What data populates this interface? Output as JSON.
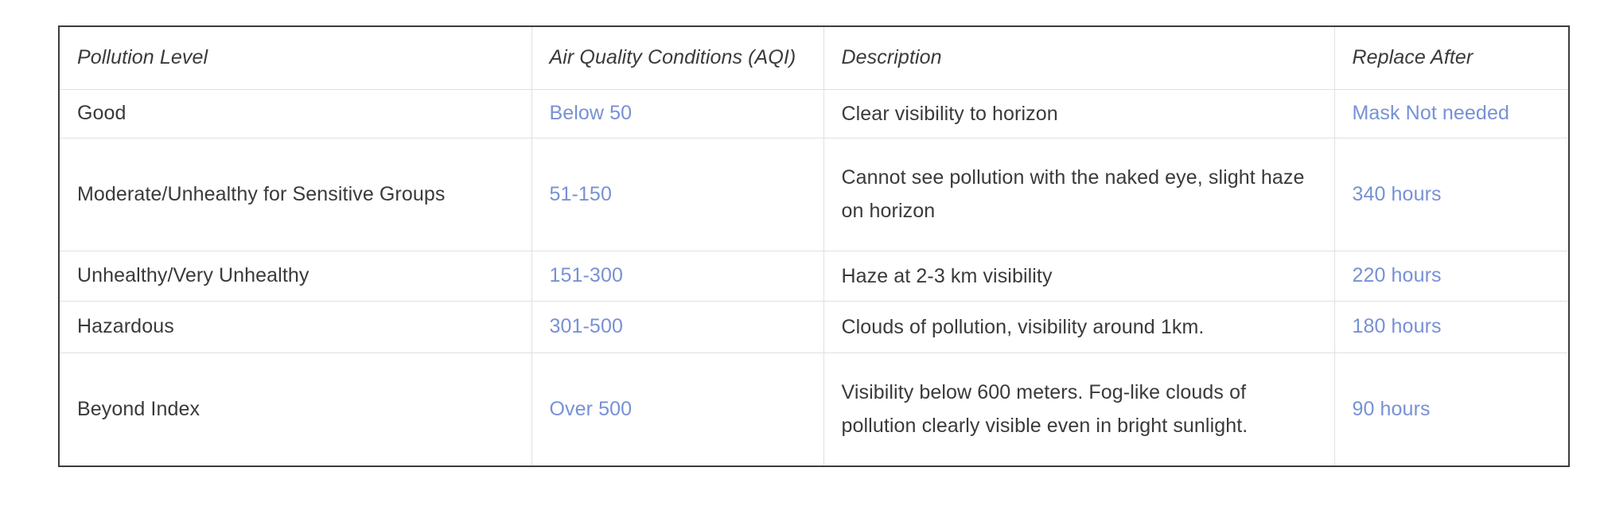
{
  "table": {
    "columns": [
      {
        "key": "pollution_level",
        "label": "Pollution Level"
      },
      {
        "key": "aqi",
        "label": "Air Quality Conditions  (AQI)"
      },
      {
        "key": "description",
        "label": "Description"
      },
      {
        "key": "replace_after",
        "label": "Replace After"
      }
    ],
    "rows": [
      {
        "pollution_level": "Good",
        "aqi": "Below 50",
        "description_line1": "Clear visibility to horizon",
        "description_line2": "",
        "replace_after": "Mask Not needed"
      },
      {
        "pollution_level": "Moderate/Unhealthy for Sensitive Groups",
        "aqi": "51-150",
        "description_line1": "Cannot see pollution with the naked eye, slight haze",
        "description_line2": "on horizon",
        "replace_after": "340 hours"
      },
      {
        "pollution_level": "Unhealthy/Very Unhealthy",
        "aqi": "151-300",
        "description_line1": "Haze at 2-3 km visibility",
        "description_line2": "",
        "replace_after": "220 hours"
      },
      {
        "pollution_level": "Hazardous",
        "aqi": "301-500",
        "description_line1": "Clouds of pollution, visibility around 1km.",
        "description_line2": "",
        "replace_after": "180 hours"
      },
      {
        "pollution_level": "Beyond Index",
        "aqi": "Over 500",
        "description_line1": "Visibility below 600 meters. Fog-like clouds of",
        "description_line2": "pollution clearly visible even in bright sunlight.",
        "replace_after": "90 hours"
      }
    ]
  },
  "colors": {
    "link_blue": "#7791d6",
    "text": "#3a3a3a",
    "outer_border": "#3c3c3c",
    "inner_border": "#e0e0e0",
    "background": "#ffffff"
  }
}
